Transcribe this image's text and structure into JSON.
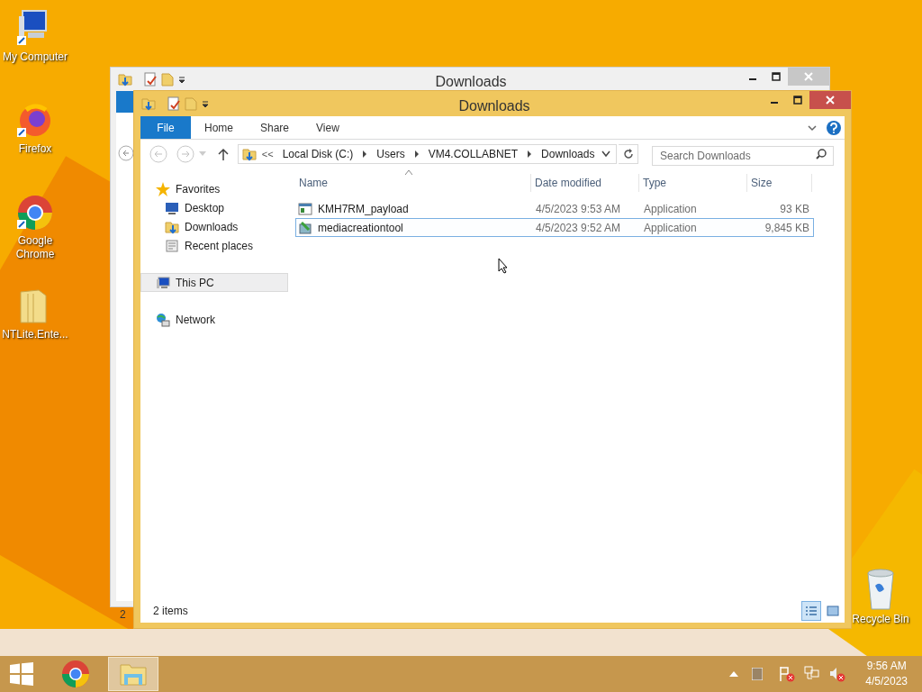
{
  "desktop_icons": [
    {
      "label": "My Computer",
      "kind": "computer"
    },
    {
      "label": "Firefox",
      "kind": "firefox"
    },
    {
      "label": "Google Chrome",
      "kind": "chrome"
    },
    {
      "label": "NTLite.Ente...",
      "kind": "folder"
    }
  ],
  "recycle_bin": {
    "label": "Recycle Bin"
  },
  "back_window": {
    "title": "Downloads",
    "status": "2"
  },
  "window": {
    "title": "Downloads",
    "ribbon_tabs": [
      {
        "label": "File",
        "kind": "file"
      },
      {
        "label": "Home",
        "kind": "tab"
      },
      {
        "label": "Share",
        "kind": "tab"
      },
      {
        "label": "View",
        "kind": "tab"
      }
    ],
    "address": {
      "overflow": "<<",
      "segments": [
        "Local Disk (C:)",
        "Users",
        "VM4.COLLABNET",
        "Downloads"
      ]
    },
    "search": {
      "placeholder": "Search Downloads"
    },
    "nav": [
      {
        "label": "Favorites",
        "kind": "star",
        "selected": false,
        "children": [
          {
            "label": "Desktop",
            "kind": "desktop",
            "selected": false
          },
          {
            "label": "Downloads",
            "kind": "downloads",
            "selected": false
          },
          {
            "label": "Recent places",
            "kind": "recent",
            "selected": false
          }
        ]
      },
      {
        "label": "This PC",
        "kind": "pc",
        "selected": true
      },
      {
        "label": "Network",
        "kind": "network",
        "selected": false
      }
    ],
    "columns": [
      "Name",
      "Date modified",
      "Type",
      "Size"
    ],
    "rows": [
      {
        "name": "KMH7RM_payload",
        "date": "4/5/2023 9:53 AM",
        "type": "Application",
        "size": "93 KB",
        "kind": "app",
        "selected": false
      },
      {
        "name": "mediacreationtool",
        "date": "4/5/2023 9:52 AM",
        "type": "Application",
        "size": "9,845 KB",
        "kind": "setup",
        "selected": true
      }
    ],
    "status": "2 items",
    "views": [
      {
        "kind": "details",
        "selected": true
      },
      {
        "kind": "tiles",
        "selected": false
      }
    ]
  },
  "taskbar": [
    {
      "kind": "start"
    },
    {
      "kind": "chrome",
      "selected": false
    },
    {
      "kind": "explorer",
      "selected": true
    }
  ],
  "tray": {
    "time": "9:56 AM",
    "date": "4/5/2023"
  }
}
